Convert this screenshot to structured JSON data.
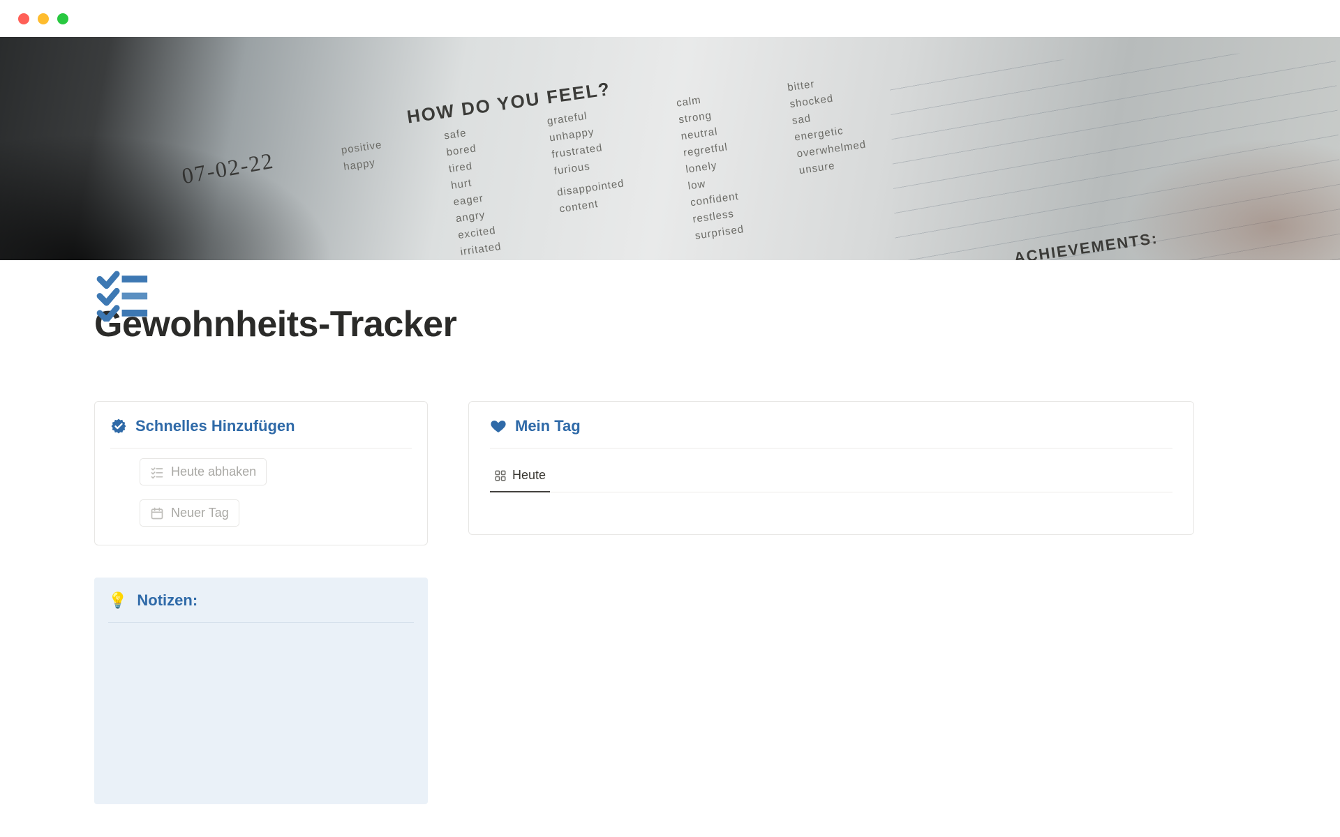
{
  "page": {
    "title": "Gewohnheits-Tracker"
  },
  "cover": {
    "journal": {
      "date_handwritten": "07-02-22",
      "header": "HOW DO YOU FEEL?",
      "achievements_label": "ACHIEVEMENTS:",
      "col1": [
        "positive",
        "happy"
      ],
      "col2": [
        "safe",
        "bored",
        "tired",
        "hurt",
        "eager",
        "angry",
        "excited",
        "irritated"
      ],
      "col3": [
        "grateful",
        "unhappy",
        "frustrated",
        "furious",
        "",
        "disappointed",
        "content"
      ],
      "col4": [
        "calm",
        "strong",
        "neutral",
        "regretful",
        "lonely",
        "low",
        "confident",
        "restless",
        "surprised"
      ],
      "col5": [
        "bitter",
        "shocked",
        "sad",
        "energetic",
        "overwhelmed",
        "unsure"
      ]
    }
  },
  "quick_add": {
    "title": "Schnelles Hinzufügen",
    "buttons": {
      "check_today": "Heute abhaken",
      "new_day": "Neuer Tag"
    }
  },
  "my_day": {
    "title": "Mein Tag",
    "tabs": {
      "today": "Heute"
    }
  },
  "notes": {
    "title": "Notizen:",
    "icon_emoji": "💡"
  },
  "colors": {
    "accent": "#2f6aa8",
    "icon_blue": "#3d78b3"
  }
}
